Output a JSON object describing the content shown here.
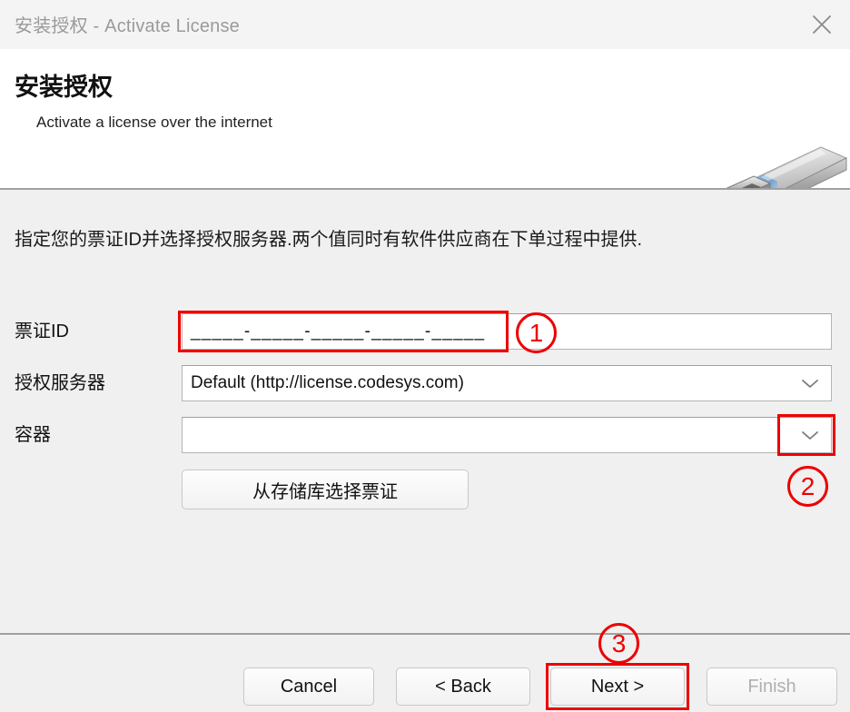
{
  "window": {
    "title": "安装授权 - Activate License",
    "close_icon": "close-x-icon"
  },
  "header": {
    "title": "安装授权",
    "subtitle": "Activate a license over the internet",
    "image_icon": "usb-dongle-icon"
  },
  "content": {
    "instruction": "指定您的票证ID并选择授权服务器.两个值同时有软件供应商在下单过程中提供.",
    "fields": [
      {
        "label": "票证ID",
        "value": "_____-_____-_____-_____-_____",
        "type": "text"
      },
      {
        "label": "授权服务器",
        "value": "Default (http://license.codesys.com)",
        "type": "combobox",
        "chevron_icon": "chevron-down-icon"
      },
      {
        "label": "容器",
        "value": "",
        "type": "combobox",
        "chevron_icon": "chevron-down-icon"
      }
    ],
    "repository_button": "从存储库选择票证"
  },
  "footer": {
    "cancel": "Cancel",
    "back": "< Back",
    "next": "Next >",
    "finish": "Finish"
  },
  "annotations": {
    "accent_color": "#ee0000",
    "markers": [
      {
        "id": "1",
        "label": "①",
        "target": "ticket-id-input"
      },
      {
        "id": "2",
        "label": "②",
        "target": "container-dropdown-chevron"
      },
      {
        "id": "3",
        "label": "③",
        "target": "next-button"
      }
    ]
  }
}
